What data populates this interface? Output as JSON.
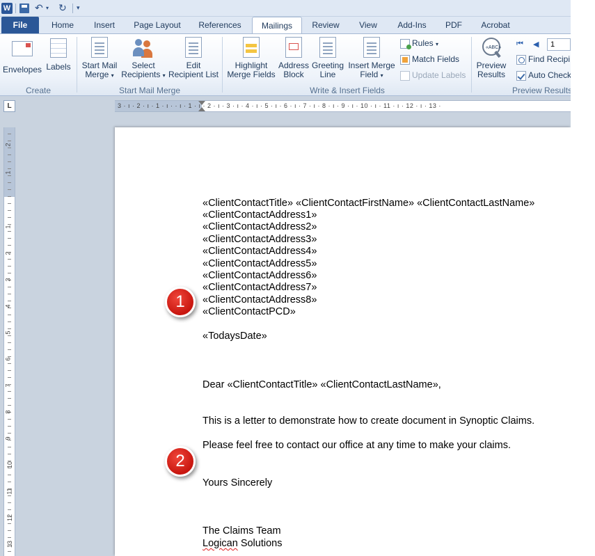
{
  "quick_access": {
    "app_icon": "word-logo-icon",
    "app_letter": "W",
    "items": [
      "save-icon",
      "undo-icon",
      "redo-icon",
      "customize-icon"
    ]
  },
  "tabs": [
    "File",
    "Home",
    "Insert",
    "Page Layout",
    "References",
    "Mailings",
    "Review",
    "View",
    "Add-Ins",
    "PDF",
    "Acrobat"
  ],
  "active_tab": "Mailings",
  "ribbon": {
    "create": {
      "label": "Create",
      "envelopes": "Envelopes",
      "labels": "Labels"
    },
    "start_mail_merge": {
      "label": "Start Mail Merge",
      "start_line1": "Start Mail",
      "start_line2": "Merge",
      "select_line1": "Select",
      "select_line2": "Recipients",
      "edit_line1": "Edit",
      "edit_line2": "Recipient List"
    },
    "write_insert": {
      "label": "Write & Insert Fields",
      "highlight_line1": "Highlight",
      "highlight_line2": "Merge Fields",
      "address_line1": "Address",
      "address_line2": "Block",
      "greeting_line1": "Greeting",
      "greeting_line2": "Line",
      "insert_line1": "Insert Merge",
      "insert_line2": "Field",
      "rules": "Rules",
      "match_fields": "Match Fields",
      "update_labels": "Update Labels"
    },
    "preview": {
      "label": "Preview Results",
      "preview_line1": "Preview",
      "preview_line2": "Results",
      "preview_icon_text": "«ABC»",
      "record_value": "1",
      "find_recipient": "Find Recipi",
      "auto_check": "Auto Check"
    }
  },
  "ruler": {
    "corner": "L",
    "ticks": "3 · ı · 2 · ı · 1 · ı · ·  ı · 1 · ı · 2 · ı · 3 · ı · 4 · ı · 5 · ı · 6 · ı · 7 · ı · 8 · ı · 9 · ı · 10 · ı · 11 · ı · 12 · ı · 13 ·",
    "vertical_numbers": [
      "2",
      "1",
      "1",
      "2",
      "3",
      "4",
      "5",
      "6",
      "7",
      "8",
      "9",
      "10",
      "11",
      "12",
      "13"
    ]
  },
  "document": {
    "lines": [
      "«ClientContactTitle» «ClientContactFirstName» «ClientContactLastName»",
      "«ClientContactAddress1»",
      "«ClientContactAddress2»",
      "«ClientContactAddress3»",
      "«ClientContactAddress4»",
      "«ClientContactAddress5»",
      "«ClientContactAddress6»",
      "«ClientContactAddress7»",
      "«ClientContactAddress8»",
      "«ClientContactPCD»"
    ],
    "date_field": "«TodaysDate»",
    "salutation": "Dear «ClientContactTitle» «ClientContactLastName»,",
    "body1": "This is a letter to demonstrate how to create document in Synoptic Claims.",
    "body2": "Please feel free to contact our office at any time to make your claims.",
    "closing": "Yours Sincerely",
    "signature1": "The Claims Team",
    "signature2_word": "Logican",
    "signature2_rest": " Solutions"
  },
  "callouts": [
    "1",
    "2"
  ],
  "colors": {
    "file_tab": "#2b5797",
    "callout_red": "#d9231a",
    "ribbon_text": "#1e395b"
  }
}
